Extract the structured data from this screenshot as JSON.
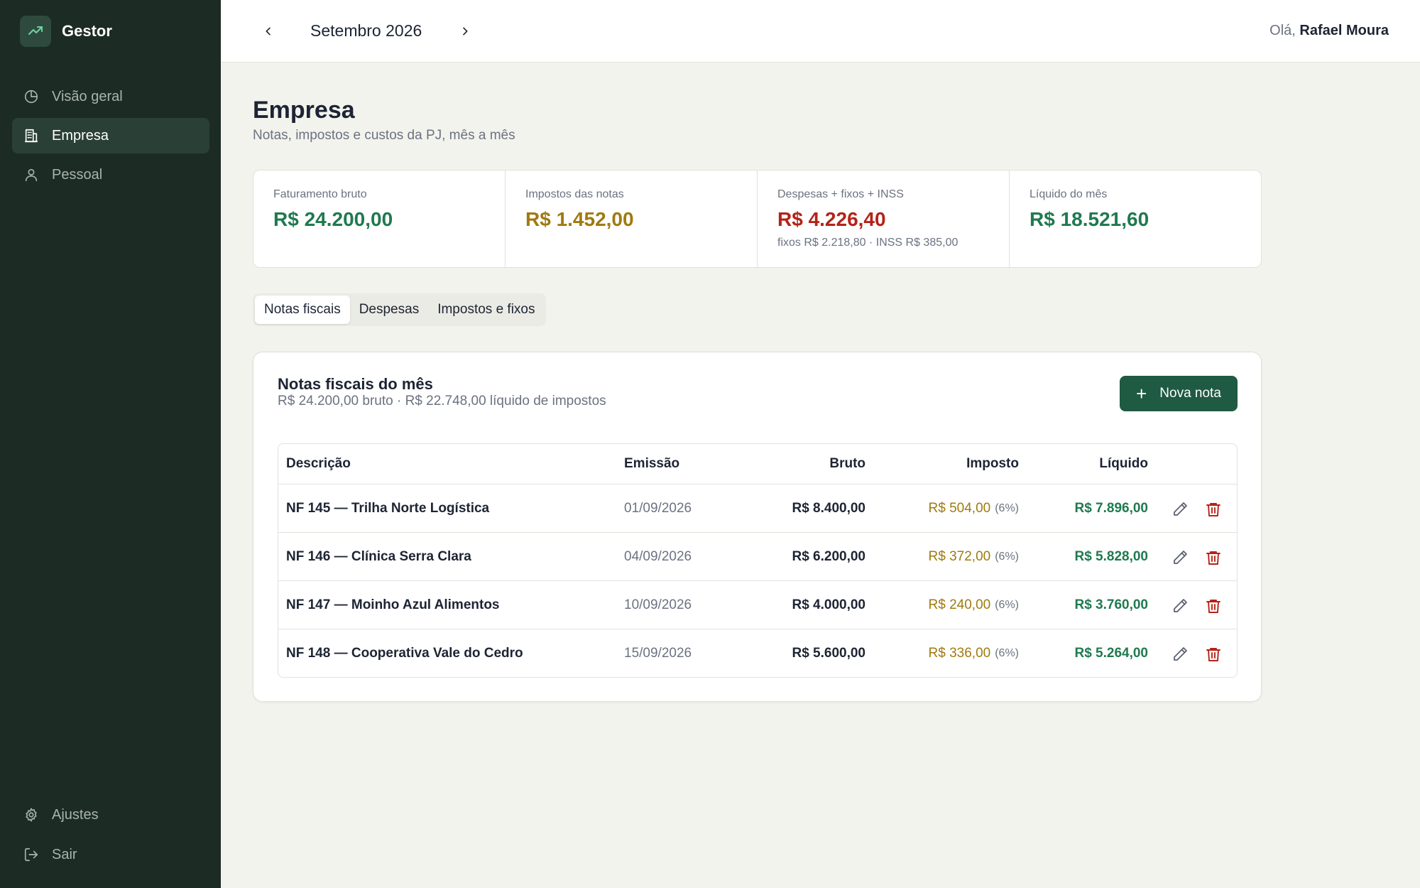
{
  "app": {
    "name": "Gestor"
  },
  "sidebar": {
    "items": [
      {
        "label": "Visão geral",
        "icon": "pie-chart-icon",
        "active": false
      },
      {
        "label": "Empresa",
        "icon": "building-icon",
        "active": true
      },
      {
        "label": "Pessoal",
        "icon": "user-icon",
        "active": false
      }
    ],
    "bottom": [
      {
        "label": "Ajustes",
        "icon": "gear-icon"
      },
      {
        "label": "Sair",
        "icon": "logout-icon"
      }
    ]
  },
  "topbar": {
    "month": "Setembro 2026",
    "greeting": "Olá,",
    "user_name": "Rafael Moura"
  },
  "page": {
    "title": "Empresa",
    "subtitle": "Notas, impostos e custos da PJ, mês a mês"
  },
  "stats": [
    {
      "label": "Faturamento bruto",
      "value": "R$ 24.200,00",
      "color": "#1f7a4f",
      "note": ""
    },
    {
      "label": "Impostos das notas",
      "value": "R$ 1.452,00",
      "color": "#a07a10",
      "note": ""
    },
    {
      "label": "Despesas + fixos + INSS",
      "value": "R$ 4.226,40",
      "color": "#b42318",
      "note": "fixos R$ 2.218,80 · INSS R$ 385,00"
    },
    {
      "label": "Líquido do mês",
      "value": "R$ 18.521,60",
      "color": "#1f7a4f",
      "note": ""
    }
  ],
  "tabs": [
    {
      "label": "Notas fiscais",
      "active": true
    },
    {
      "label": "Despesas",
      "active": false
    },
    {
      "label": "Impostos e fixos",
      "active": false
    }
  ],
  "panel": {
    "title": "Notas fiscais do mês",
    "subtitle": "R$ 24.200,00 bruto · R$ 22.748,00 líquido de impostos",
    "new_button": "Nova nota"
  },
  "table": {
    "headers": {
      "desc": "Descrição",
      "date": "Emissão",
      "gross": "Bruto",
      "tax": "Imposto",
      "net": "Líquido"
    },
    "rows": [
      {
        "desc": "NF 145 — Trilha Norte Logística",
        "date": "01/09/2026",
        "gross": "R$ 8.400,00",
        "tax": "R$ 504,00",
        "pct": "(6%)",
        "net": "R$ 7.896,00"
      },
      {
        "desc": "NF 146 — Clínica Serra Clara",
        "date": "04/09/2026",
        "gross": "R$ 6.200,00",
        "tax": "R$ 372,00",
        "pct": "(6%)",
        "net": "R$ 5.828,00"
      },
      {
        "desc": "NF 147 — Moinho Azul Alimentos",
        "date": "10/09/2026",
        "gross": "R$ 4.000,00",
        "tax": "R$ 240,00",
        "pct": "(6%)",
        "net": "R$ 3.760,00"
      },
      {
        "desc": "NF 148 — Cooperativa Vale do Cedro",
        "date": "15/09/2026",
        "gross": "R$ 5.600,00",
        "tax": "R$ 336,00",
        "pct": "(6%)",
        "net": "R$ 5.264,00"
      }
    ]
  },
  "colors": {
    "sidebar_bg": "#1c2b24",
    "accent": "#1f5a42",
    "positive": "#1f7a4f",
    "tax": "#a07a10",
    "negative": "#b42318"
  }
}
